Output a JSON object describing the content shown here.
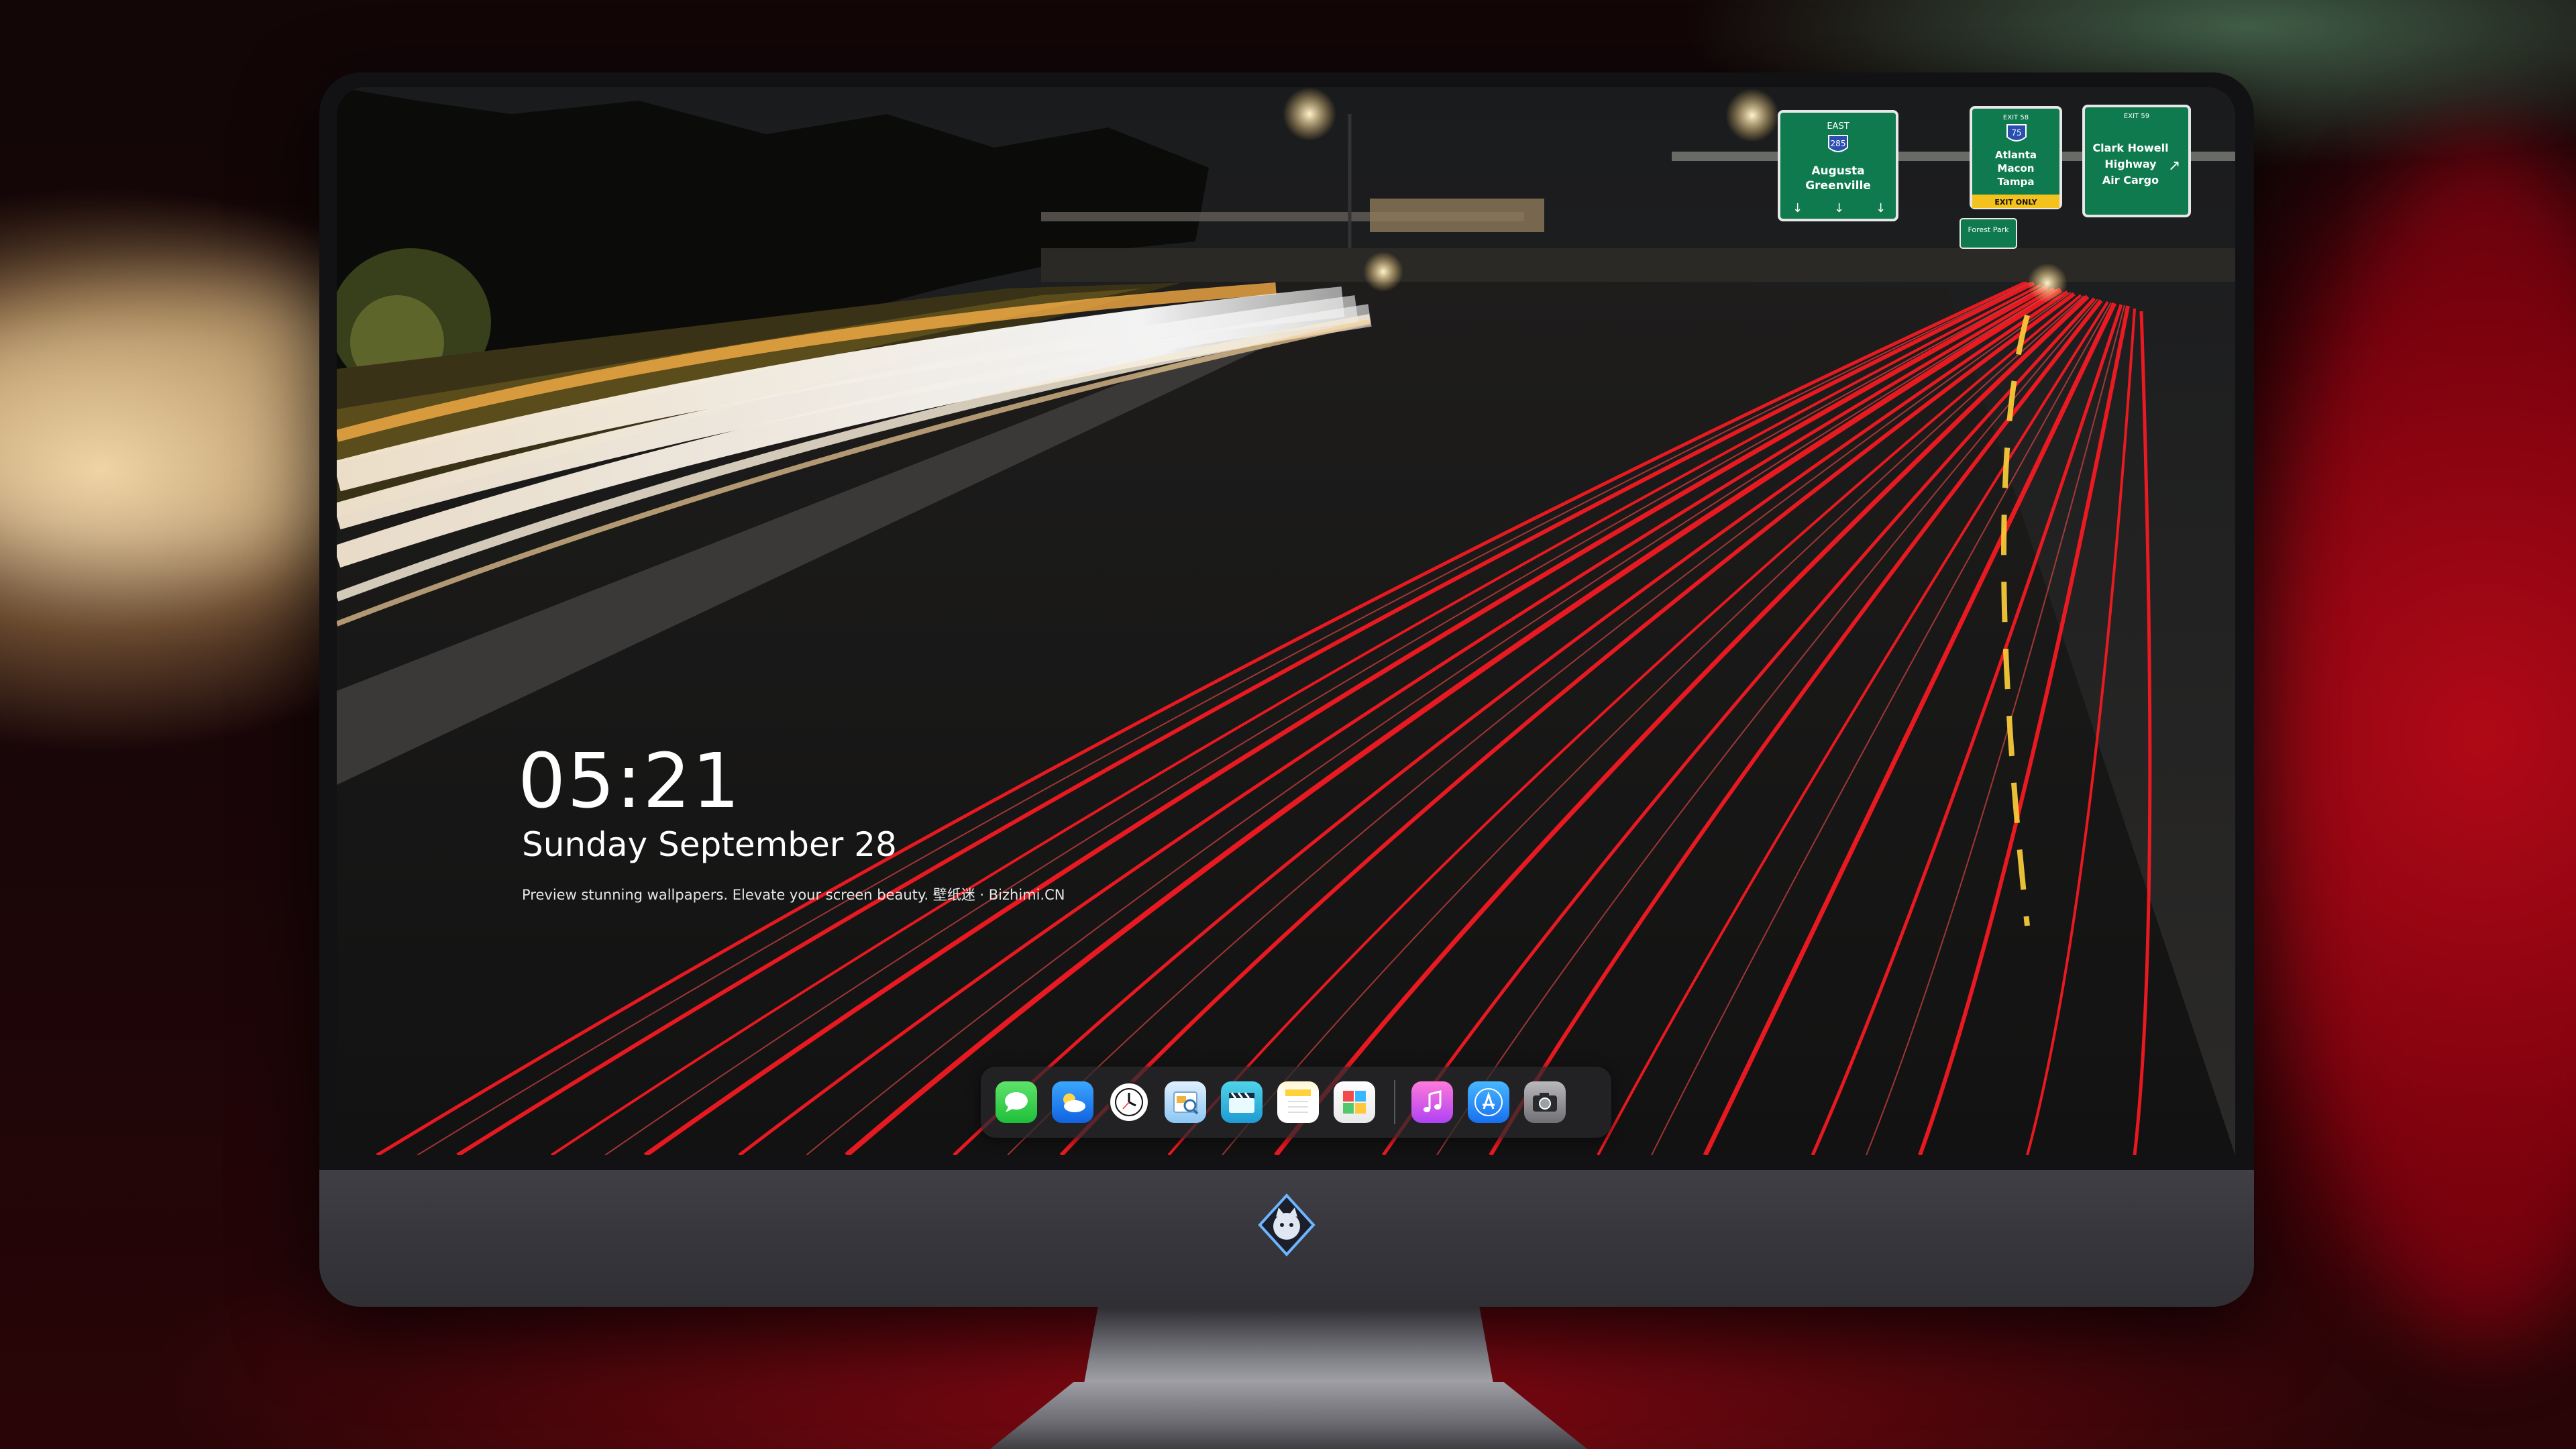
{
  "lockscreen": {
    "time": "05:21",
    "date": "Sunday September  28",
    "tagline": "Preview stunning wallpapers. Elevate your screen beauty. 壁纸迷 · Bizhimi.CN"
  },
  "highway_signs": [
    {
      "top": "EAST",
      "route": "285",
      "lines": [
        "Augusta",
        "Greenville"
      ]
    },
    {
      "top": "EXIT 58",
      "route": "75",
      "lines": [
        "Atlanta",
        "Macon",
        "Tampa"
      ],
      "badge": "EXIT ONLY"
    },
    {
      "top": "EXIT 59",
      "route": "",
      "lines": [
        "Clark Howell",
        "Highway",
        "Air Cargo"
      ]
    },
    {
      "top": "",
      "route": "",
      "lines": [
        "Forest Park"
      ]
    }
  ],
  "dock": {
    "items": [
      {
        "name": "messages-icon",
        "glyph": "💬"
      },
      {
        "name": "weather-icon",
        "glyph": "⛅"
      },
      {
        "name": "clock-icon",
        "glyph": ""
      },
      {
        "name": "preview-icon",
        "glyph": ""
      },
      {
        "name": "video-icon",
        "glyph": ""
      },
      {
        "name": "notes-icon",
        "glyph": ""
      },
      {
        "name": "photos-icon",
        "glyph": ""
      }
    ],
    "apps_right": [
      {
        "name": "music-icon",
        "glyph": "♫"
      },
      {
        "name": "app-store-icon",
        "glyph": "A"
      },
      {
        "name": "camera-icon",
        "glyph": ""
      }
    ]
  },
  "colors": {
    "bezel": "#121215",
    "chin": "#3a3a40",
    "sign_green": "#0f7a4e",
    "light_trail_red": "#e0141c",
    "light_trail_white": "#fff6e6"
  }
}
